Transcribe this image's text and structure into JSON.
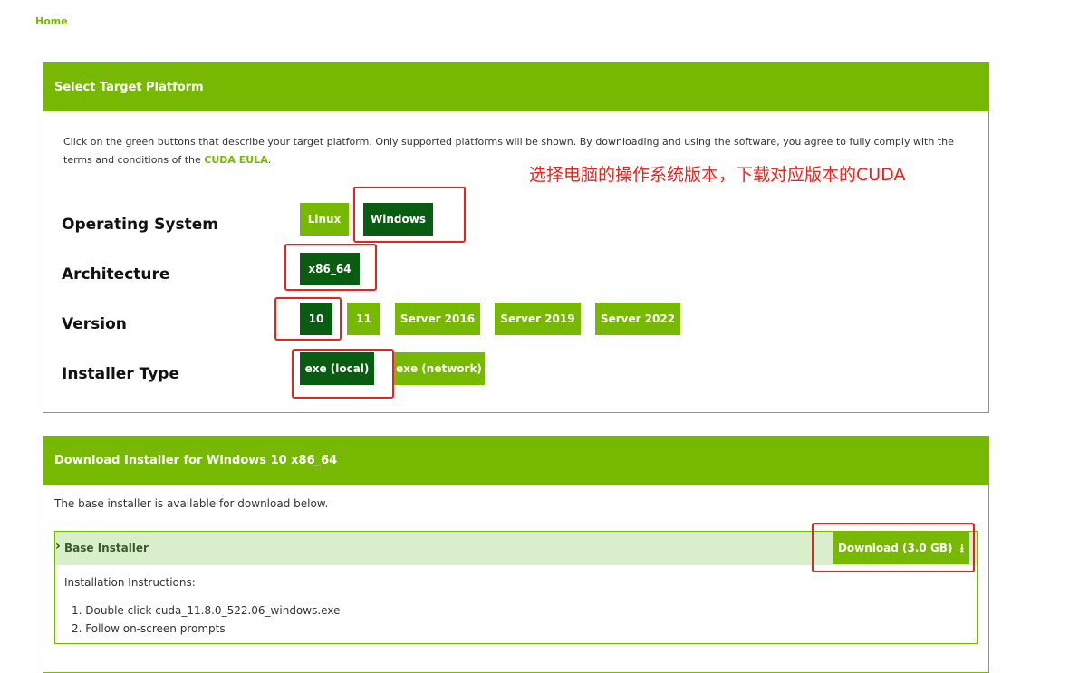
{
  "home": "Home",
  "panel1": {
    "title": "Select Target Platform",
    "intro_text": "Click on the green buttons that describe your target platform. Only supported platforms will be shown. By downloading and using the software, you agree to fully comply with the terms and conditions of the",
    "eula_link": "CUDA EULA",
    "intro_end": "."
  },
  "annotation": "选择电脑的操作系统版本，下载对应版本的CUDA",
  "rows": {
    "os": {
      "label": "Operating System",
      "options": [
        "Linux",
        "Windows"
      ],
      "selected": "Windows"
    },
    "arch": {
      "label": "Architecture",
      "options": [
        "x86_64"
      ],
      "selected": "x86_64"
    },
    "version": {
      "label": "Version",
      "options": [
        "10",
        "11",
        "Server 2016",
        "Server 2019",
        "Server 2022"
      ],
      "selected": "10"
    },
    "installer": {
      "label": "Installer Type",
      "options": [
        "exe (local)",
        "exe (network)"
      ],
      "selected": "exe (local)"
    }
  },
  "panel2": {
    "title": "Download Installer for Windows 10 x86_64",
    "intro": "The base installer is available for download below.",
    "section_title": "Base Installer",
    "download_label": "Download (3.0 GB)",
    "instructions_title": "Installation Instructions:",
    "steps": [
      "Double click cuda_11.8.0_522.06_windows.exe",
      "Follow on-screen prompts"
    ]
  },
  "colors": {
    "accent": "#76b900",
    "selected": "#0a5c12",
    "highlight": "#e8231b",
    "section_bg": "#d9efcb"
  }
}
